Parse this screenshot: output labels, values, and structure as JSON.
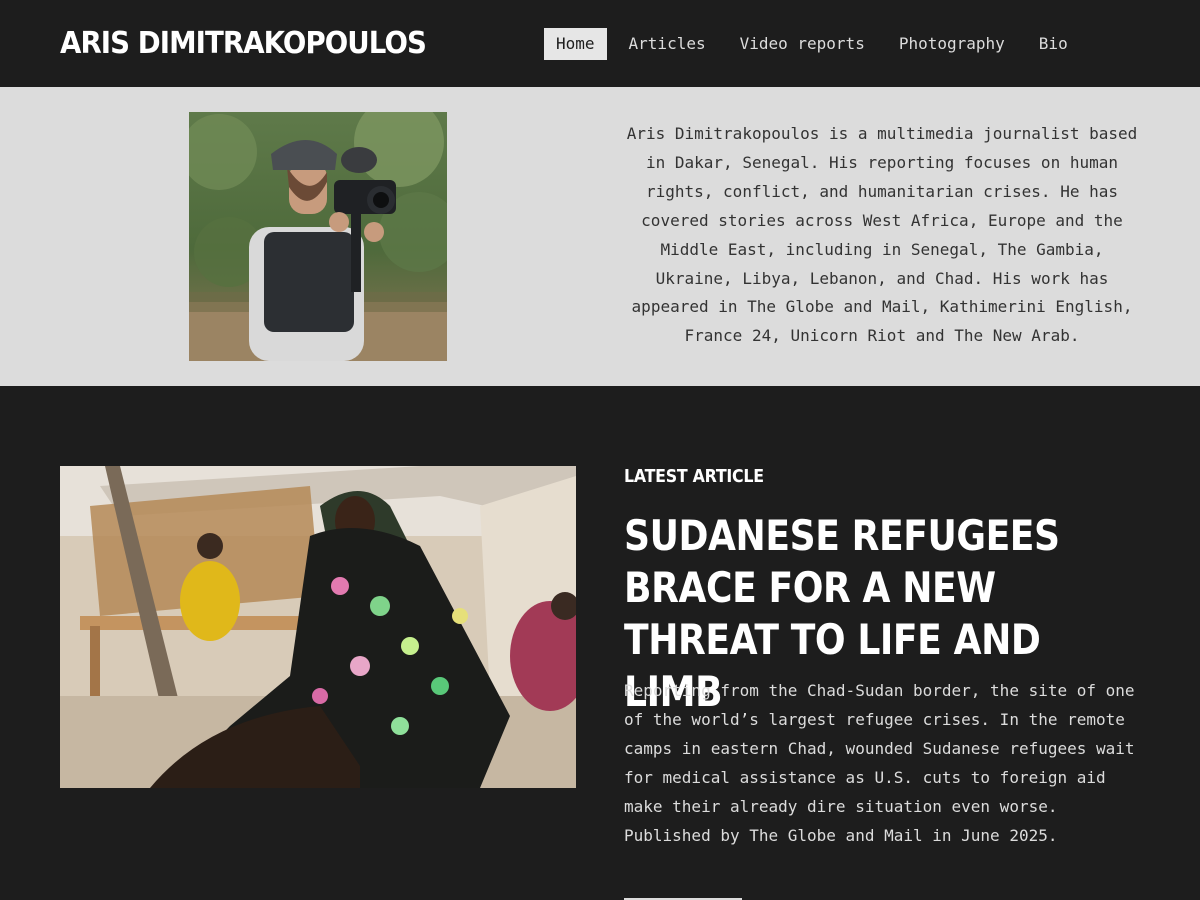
{
  "site": {
    "title": "ARIS DIMITRAKOPOULOS"
  },
  "nav": {
    "items": [
      {
        "label": "Home",
        "active": true
      },
      {
        "label": "Articles"
      },
      {
        "label": "Video reports"
      },
      {
        "label": "Photography"
      },
      {
        "label": "Bio"
      }
    ]
  },
  "bio": {
    "text": "Aris Dimitrakopoulos is a multimedia journalist based in Dakar, Senegal. His reporting focuses on human rights, conflict, and humanitarian crises. He has covered stories across West Africa, Europe and the Middle East, including in Senegal, The Gambia, Ukraine, Libya, Lebanon, and Chad. His work has appeared in The Globe and Mail, Kathimerini English, France 24, Unicorn Riot and The New Arab."
  },
  "latest": {
    "kicker": "LATEST ARTICLE",
    "headline": "SUDANESE REFUGEES BRACE FOR A NEW THREAT TO LIFE AND LIMB",
    "summary": "Reporting from the Chad-Sudan border, the site of one of the world’s largest refugee crises. In the remote camps in eastern Chad, wounded Sudanese refugees wait for medical assistance as U.S. cuts to foreign aid make their already dire situation even worse. Published by The Globe and Mail in June 2025."
  },
  "colors": {
    "background": "#1d1d1d",
    "band": "#dcdcdc",
    "nav_active_bg": "#e6e6e6"
  }
}
